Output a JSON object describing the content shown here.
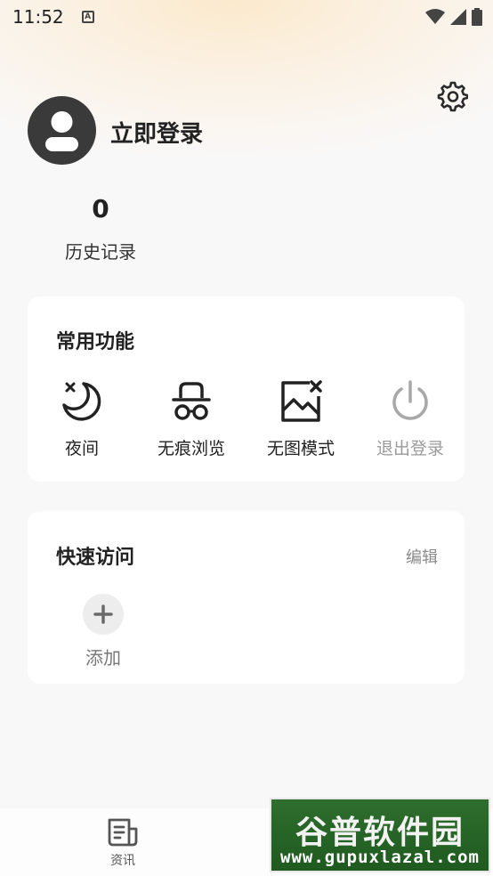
{
  "status_bar": {
    "time": "11:52",
    "notification_badge": "A"
  },
  "profile": {
    "login_label": "立即登录",
    "history_count": "0",
    "history_label": "历史记录"
  },
  "common_functions": {
    "title": "常用功能",
    "items": [
      {
        "label": "夜间",
        "icon": "moon-icon"
      },
      {
        "label": "无痕浏览",
        "icon": "incognito-icon"
      },
      {
        "label": "无图模式",
        "icon": "no-image-icon"
      },
      {
        "label": "退出登录",
        "icon": "power-icon",
        "disabled": true
      }
    ]
  },
  "quick_access": {
    "title": "快速访问",
    "edit_label": "编辑",
    "add_label": "添加"
  },
  "bottom_nav": {
    "items": [
      {
        "label": "资讯",
        "icon": "news-icon"
      }
    ]
  },
  "watermark": {
    "title": "谷普软件园",
    "url": "www.gupuxlazal.com"
  },
  "colors": {
    "accent_gold": "#fbe9cc",
    "text_primary": "#222222",
    "disabled": "#9a9a9a",
    "watermark_green": "#2e6e2e"
  }
}
